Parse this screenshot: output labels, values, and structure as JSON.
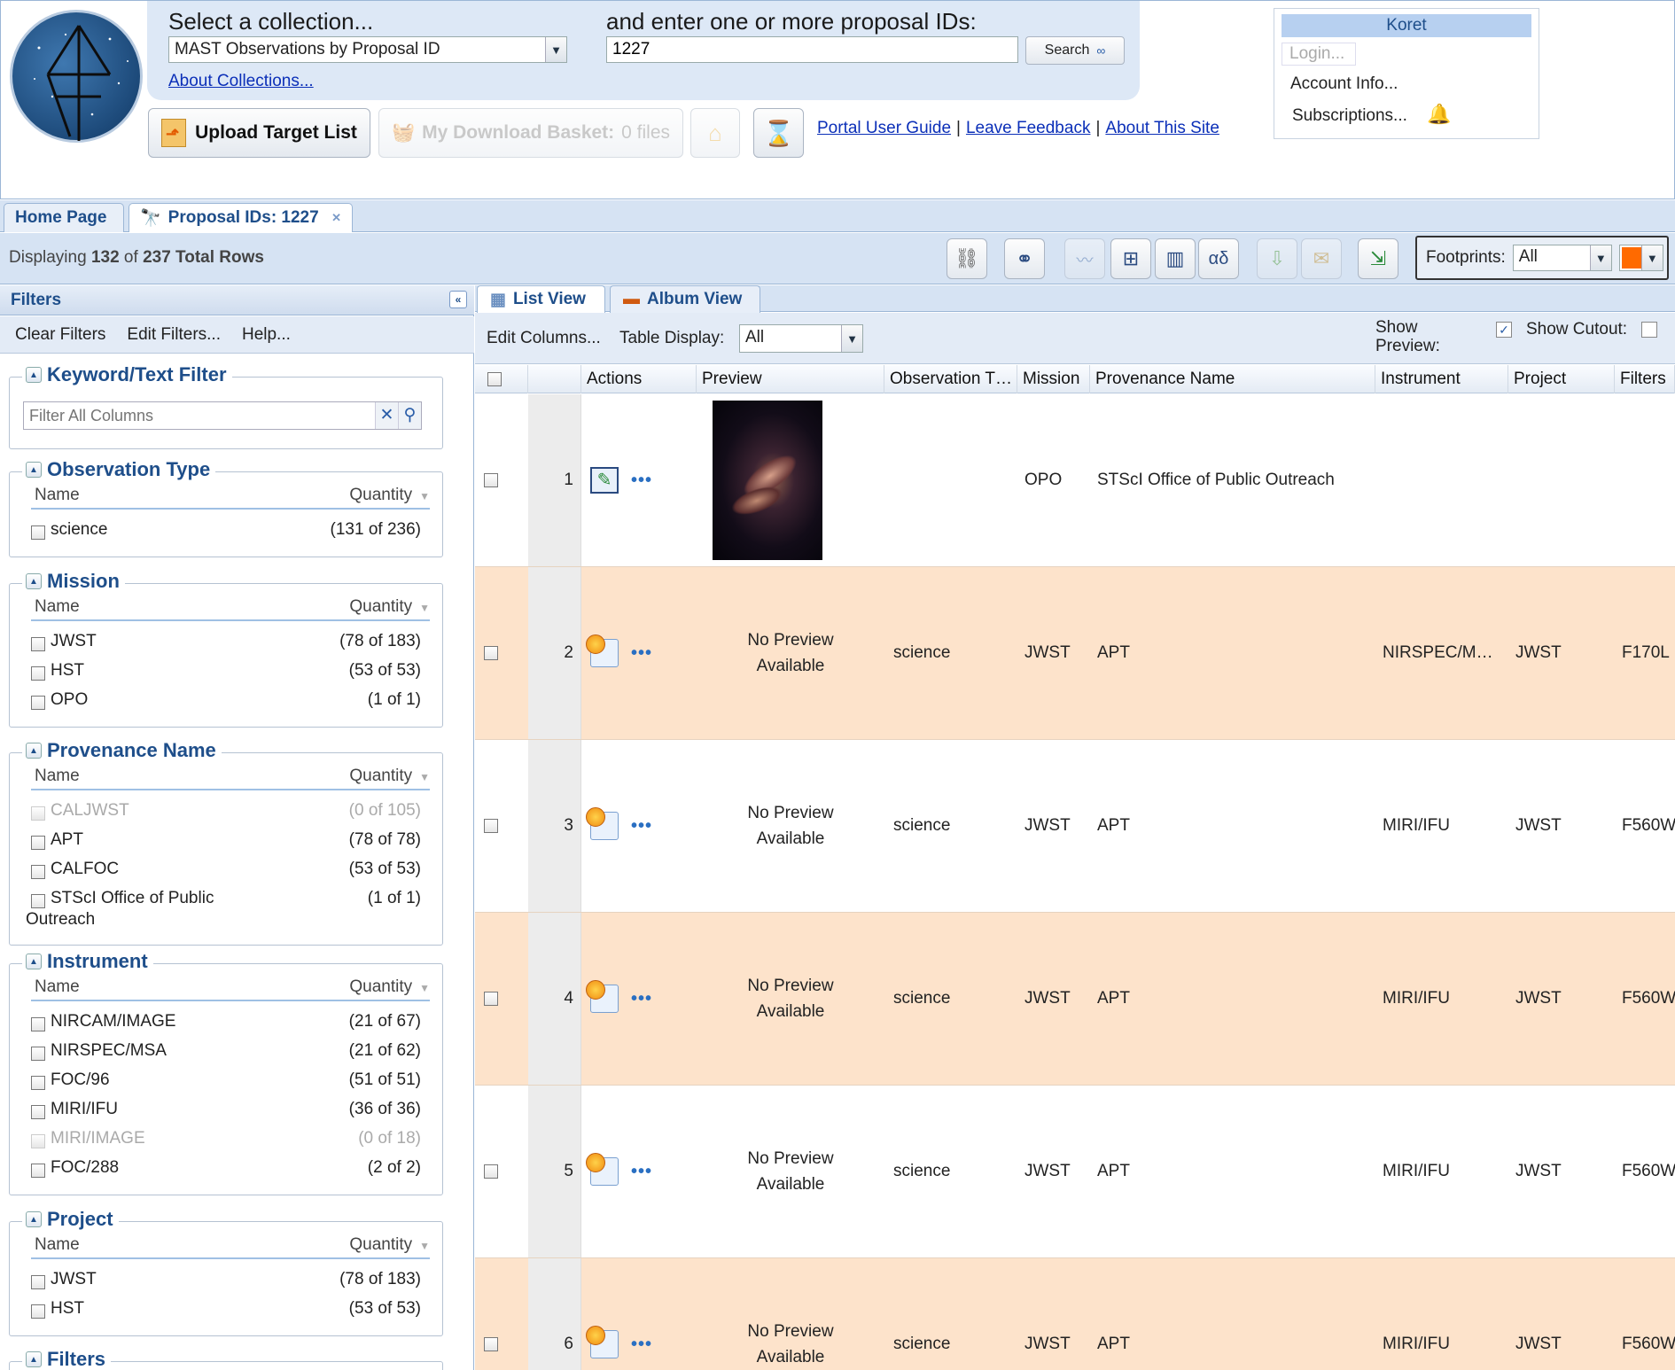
{
  "header": {
    "select_collection_label": "Select a collection...",
    "collection_value": "MAST Observations by Proposal ID",
    "about_collections": "About Collections...",
    "enter_ids_label": "and enter one or more proposal IDs:",
    "proposal_input_value": "1227",
    "search_button": "Search",
    "upload_button": "Upload Target List",
    "download_basket_label": "My Download Basket:",
    "download_basket_count": "0 files",
    "links": {
      "guide": "Portal User Guide",
      "sep": "|",
      "feedback": "Leave Feedback",
      "about": "About This Site"
    }
  },
  "user": {
    "name": "Koret",
    "login": "Login...",
    "account": "Account Info...",
    "subscriptions": "Subscriptions..."
  },
  "tabs": {
    "home": "Home Page",
    "proposal": "Proposal IDs: 1227"
  },
  "toolbar": {
    "displaying_prefix": "Displaying",
    "shown": "132",
    "of": "of",
    "total": "237 Total Rows",
    "footprints_label": "Footprints:",
    "footprints_value": "All",
    "footprint_color": "#ff6a00"
  },
  "filters": {
    "title": "Filters",
    "menu": {
      "clear": "Clear Filters",
      "edit": "Edit Filters...",
      "help": "Help..."
    },
    "keyword": {
      "title": "Keyword/Text Filter",
      "placeholder": "Filter All Columns"
    },
    "col_name": "Name",
    "col_qty": "Quantity",
    "sections": {
      "obs_type": {
        "title": "Observation Type",
        "items": [
          {
            "name": "science",
            "qty": "(131 of 236)"
          }
        ]
      },
      "mission": {
        "title": "Mission",
        "items": [
          {
            "name": "JWST",
            "qty": "(78 of 183)"
          },
          {
            "name": "HST",
            "qty": "(53 of 53)"
          },
          {
            "name": "OPO",
            "qty": "(1 of 1)"
          }
        ]
      },
      "provenance": {
        "title": "Provenance Name",
        "items": [
          {
            "name": "CALJWST",
            "qty": "(0 of 105)"
          },
          {
            "name": "APT",
            "qty": "(78 of 78)"
          },
          {
            "name": "CALFOC",
            "qty": "(53 of 53)"
          },
          {
            "name": "STScI Office of Public",
            "name2": "Outreach",
            "qty": "(1 of 1)"
          }
        ]
      },
      "instrument": {
        "title": "Instrument",
        "items": [
          {
            "name": "NIRCAM/IMAGE",
            "qty": "(21 of 67)"
          },
          {
            "name": "NIRSPEC/MSA",
            "qty": "(21 of 62)"
          },
          {
            "name": "FOC/96",
            "qty": "(51 of 51)"
          },
          {
            "name": "MIRI/IFU",
            "qty": "(36 of 36)"
          },
          {
            "name": "MIRI/IMAGE",
            "qty": "(0 of 18)"
          },
          {
            "name": "FOC/288",
            "qty": "(2 of 2)"
          }
        ]
      },
      "project": {
        "title": "Project",
        "items": [
          {
            "name": "JWST",
            "qty": "(78 of 183)"
          },
          {
            "name": "HST",
            "qty": "(53 of 53)"
          }
        ]
      },
      "filters_sec": {
        "title": "Filters"
      }
    }
  },
  "results": {
    "view_tabs": {
      "list": "List View",
      "album": "Album View"
    },
    "edit_columns": "Edit Columns...",
    "table_display_label": "Table Display:",
    "table_display_value": "All",
    "show_preview": "Show Preview:",
    "show_cutout": "Show Cutout:",
    "columns": {
      "actions": "Actions",
      "preview": "Preview",
      "obs_type": "Observation T…",
      "mission": "Mission",
      "provenance": "Provenance Name",
      "instrument": "Instrument",
      "project": "Project",
      "filters": "Filters"
    },
    "no_preview_1": "No Preview",
    "no_preview_2": "Available",
    "rows": [
      {
        "n": "1",
        "obs_type": "",
        "mission": "OPO",
        "provenance": "STScI Office of Public Outreach",
        "instrument": "",
        "project": "",
        "filters": ""
      },
      {
        "n": "2",
        "obs_type": "science",
        "mission": "JWST",
        "provenance": "APT",
        "instrument": "NIRSPEC/M…",
        "project": "JWST",
        "filters": "F170L"
      },
      {
        "n": "3",
        "obs_type": "science",
        "mission": "JWST",
        "provenance": "APT",
        "instrument": "MIRI/IFU",
        "project": "JWST",
        "filters": "F560W"
      },
      {
        "n": "4",
        "obs_type": "science",
        "mission": "JWST",
        "provenance": "APT",
        "instrument": "MIRI/IFU",
        "project": "JWST",
        "filters": "F560W"
      },
      {
        "n": "5",
        "obs_type": "science",
        "mission": "JWST",
        "provenance": "APT",
        "instrument": "MIRI/IFU",
        "project": "JWST",
        "filters": "F560W"
      },
      {
        "n": "6",
        "obs_type": "science",
        "mission": "JWST",
        "provenance": "APT",
        "instrument": "MIRI/IFU",
        "project": "JWST",
        "filters": "F560W"
      }
    ]
  }
}
